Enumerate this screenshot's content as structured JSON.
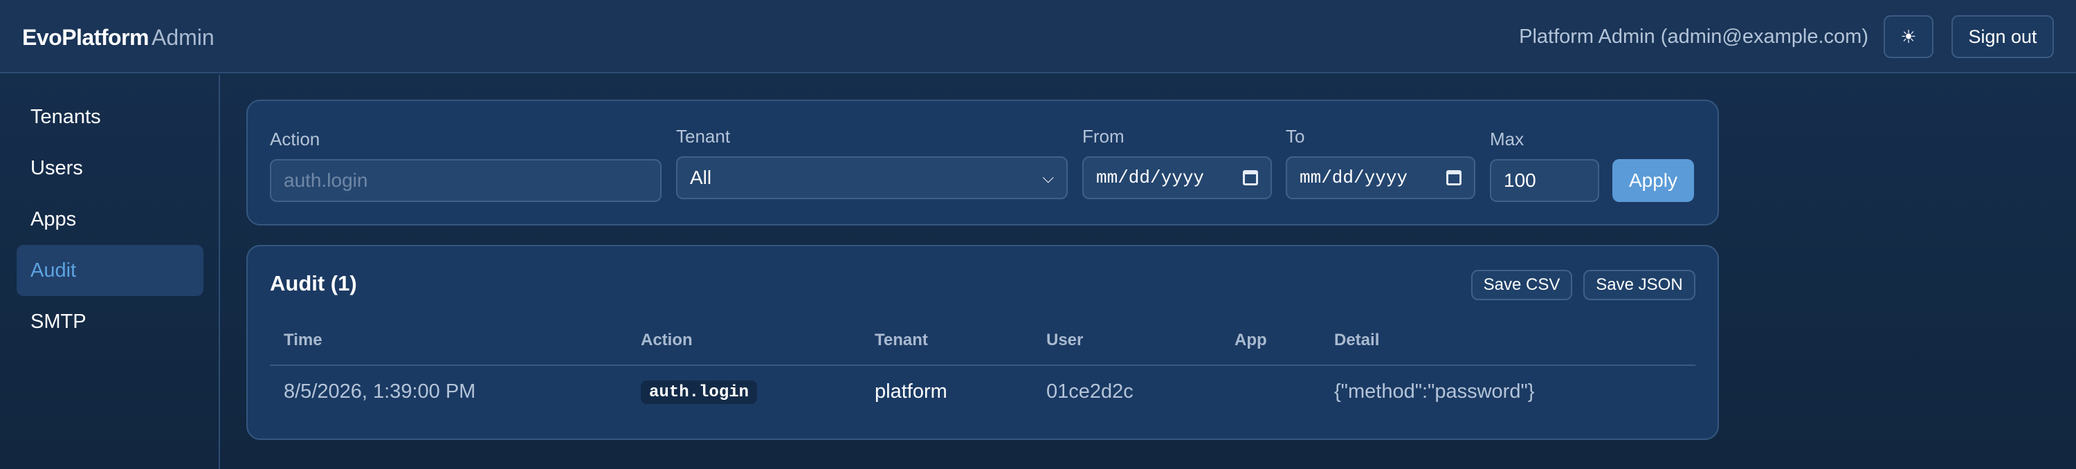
{
  "header": {
    "brand": "EvoPlatform",
    "brand_sub": "Admin",
    "user": "Platform Admin (admin@example.com)",
    "theme_icon": "☀",
    "signout_label": "Sign out"
  },
  "sidebar": {
    "items": [
      {
        "label": "Tenants"
      },
      {
        "label": "Users"
      },
      {
        "label": "Apps"
      },
      {
        "label": "Audit",
        "active": true
      },
      {
        "label": "SMTP"
      }
    ]
  },
  "filters": {
    "action_label": "Action",
    "action_placeholder": "auth.login",
    "tenant_label": "Tenant",
    "tenant_value": "All",
    "from_label": "From",
    "from_value": "mm/dd/yyyy",
    "to_label": "To",
    "to_value": "mm/dd/yyyy",
    "max_label": "Max",
    "max_value": "100",
    "apply_label": "Apply"
  },
  "audit": {
    "title": "Audit (1)",
    "save_csv_label": "Save CSV",
    "save_json_label": "Save JSON",
    "columns": [
      "Time",
      "Action",
      "Tenant",
      "User",
      "App",
      "Detail"
    ],
    "rows": [
      {
        "time": "8/5/2026, 1:39:00 PM",
        "action": "auth.login",
        "tenant": "platform",
        "user": "01ce2d2c",
        "app": "",
        "detail": "{\"method\":\"password\"}"
      }
    ]
  },
  "colors": {
    "accent": "#5b9bd8",
    "active_nav_text": "#5da3e0",
    "background": "#162f4f"
  }
}
